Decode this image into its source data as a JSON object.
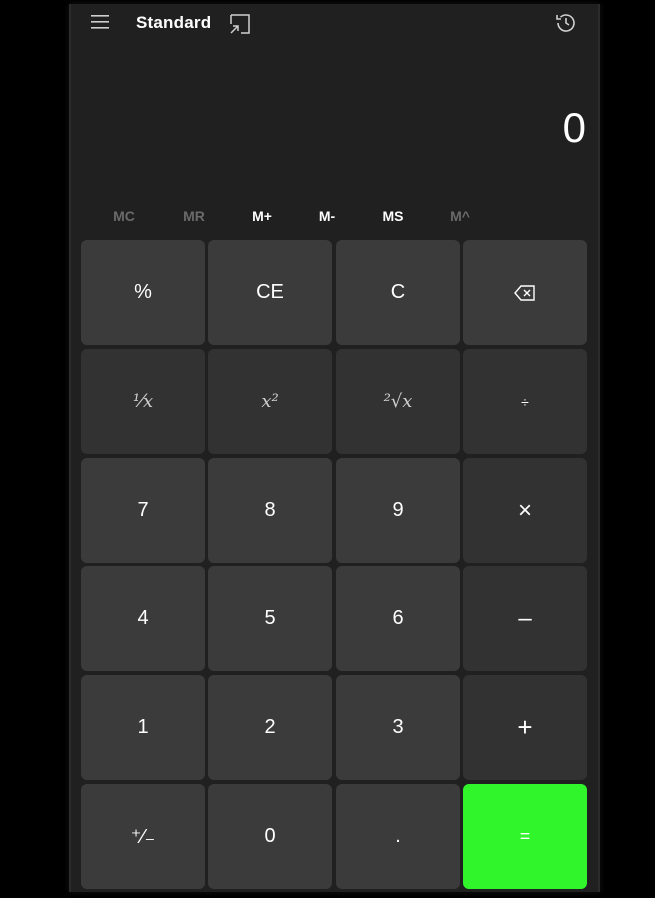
{
  "header": {
    "title": "Standard"
  },
  "display": {
    "value": "0"
  },
  "memory": {
    "mc": "MC",
    "mr": "MR",
    "mplus": "M+",
    "mminus": "M-",
    "ms": "MS",
    "mlist": "M^"
  },
  "keys": {
    "percent": "%",
    "ce": "CE",
    "c": "C",
    "reciprocal": "¹⁄x",
    "square": "x²",
    "sqrt": "²√x",
    "divide": "÷",
    "seven": "7",
    "eight": "8",
    "nine": "9",
    "multiply": "×",
    "four": "4",
    "five": "5",
    "six": "6",
    "minus": "–",
    "one": "1",
    "two": "2",
    "three": "3",
    "plus": "+",
    "negate": "⁺⁄₋",
    "zero": "0",
    "decimal": ".",
    "equals": "="
  },
  "colors": {
    "window_bg": "#202020",
    "key_bg": "#3b3b3b",
    "equals_bg": "#2ff52a"
  }
}
